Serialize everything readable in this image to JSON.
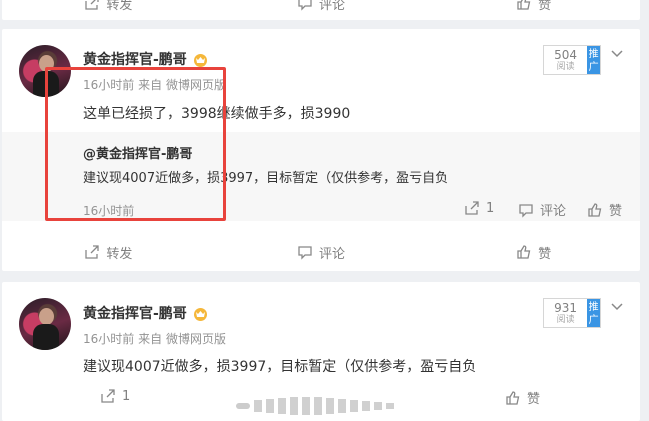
{
  "top_card": {
    "repost_label": "转发",
    "comment_label": "评论",
    "like_label": "赞"
  },
  "post1": {
    "author": "黄金指挥官-鹏哥",
    "time": "16小时前",
    "source_prefix": "来自",
    "source": "微博网页版",
    "text": "这单已经损了，3998继续做手多，损3990",
    "reads": "504",
    "reads_label": "阅读",
    "promote_label": "推广",
    "repost": {
      "author": "@黄金指挥官-鹏哥",
      "text": "建议现4007近做多，损3997，目标暂定（仅供参考，盈亏自负",
      "time": "16小时前",
      "repost_count": "1",
      "comment_label": "评论",
      "like_label": "赞"
    },
    "actions": {
      "repost_label": "转发",
      "comment_label": "评论",
      "like_label": "赞"
    }
  },
  "post2": {
    "author": "黄金指挥官-鹏哥",
    "time": "16小时前",
    "source_prefix": "来自",
    "source": "微博网页版",
    "text": "建议现4007近做多，损3997，目标暂定（仅供参考，盈亏自负",
    "reads": "931",
    "reads_label": "阅读",
    "promote_label": "推广",
    "actions": {
      "repost_count": "1",
      "like_label": "赞"
    }
  }
}
